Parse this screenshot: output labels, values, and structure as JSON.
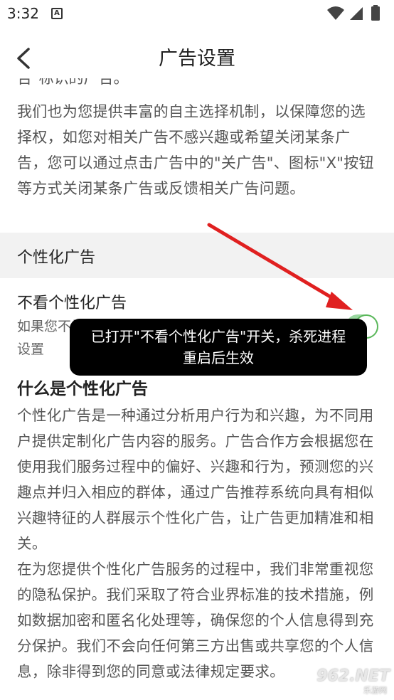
{
  "status_bar": {
    "time": "3:32",
    "notification_badge": "A"
  },
  "header": {
    "title": "广告设置"
  },
  "intro": {
    "cut_line": "告\"标识的广告。",
    "paragraph": "我们也为您提供丰富的自主选择机制，以保障您的选择权，如您对相关广告不感兴趣或希望关闭某条广告，您可以通过点击广告中的\"关广告\"、图标\"X\"按钮等方式关闭某条广告或反馈相关广告问题。"
  },
  "section": {
    "title": "个性化广告"
  },
  "option": {
    "title": "不看个性化广告",
    "description": "如果您不希望看到个性化广告服务，您可以在此随时设置",
    "enabled": true
  },
  "what_is": {
    "title": "什么是个性化广告",
    "paragraph1": "个性化广告是一种通过分析用户行为和兴趣，为不同用户提供定制化广告内容的服务。广告合作方会根据您在使用我们服务过程中的偏好、兴趣和行为，预测您的兴趣点并归入相应的群体，通过广告推荐系统向具有相似兴趣特征的人群展示个性化广告，让广告更加精准和相关。",
    "paragraph2": "在为您提供个性化广告服务的过程中，我们非常重视您的隐私保护。我们采取了符合业界标准的技术措施，例如数据加密和匿名化处理等，确保您的个人信息得到充分保护。我们不会向任何第三方出售或共享您的个人信息，除非得到您的同意或法律规定要求。"
  },
  "toast": {
    "line1": "已打开\"不看个性化广告\"开关，杀死进程",
    "line2": "重启后生效"
  },
  "watermark": {
    "text": "962.NET",
    "sub": "乐游网"
  },
  "colors": {
    "switch_on": "#5cb85c",
    "arrow": "#e02020",
    "toast_bg": "#000000"
  }
}
